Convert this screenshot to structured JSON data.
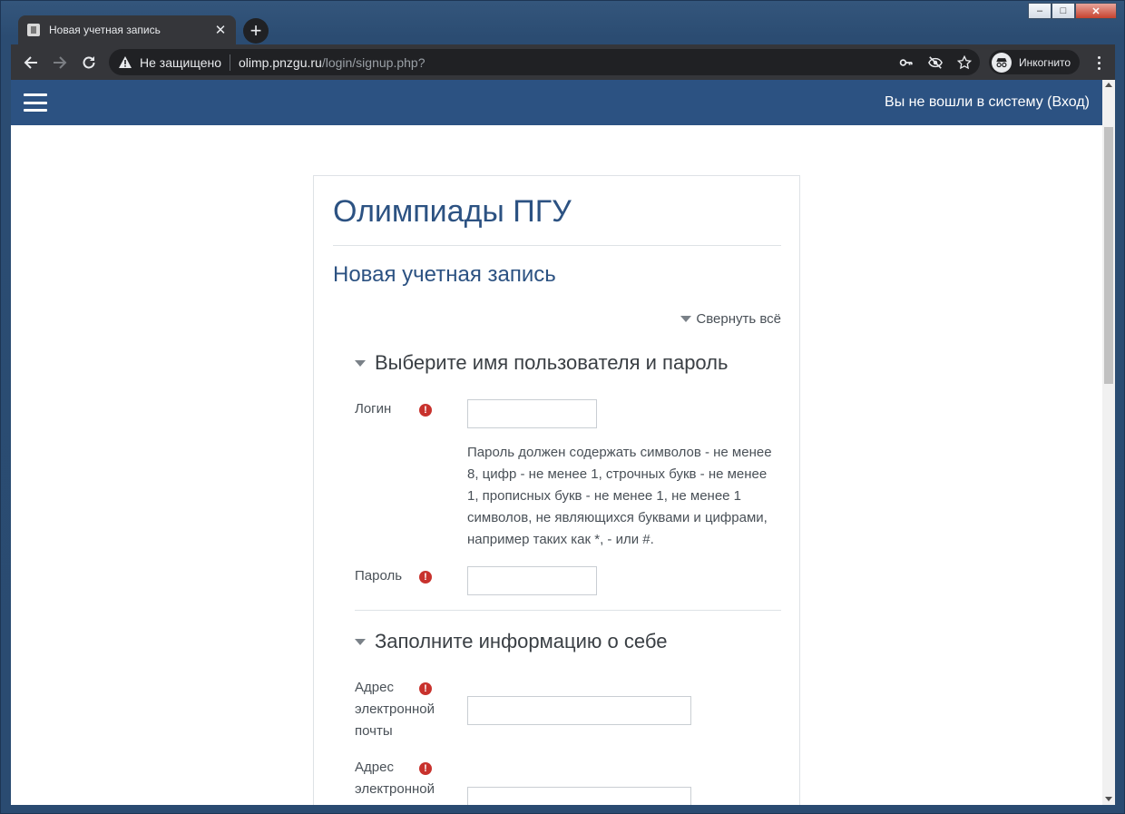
{
  "browser": {
    "tab_title": "Новая учетная запись",
    "security_label": "Не защищено",
    "url_host": "olimp.pnzgu.ru",
    "url_path": "/login/signup.php?",
    "incognito_label": "Инкогнито"
  },
  "navbar": {
    "login_status": "Вы не вошли в систему (Вход)"
  },
  "page": {
    "site_title": "Олимпиады ПГУ",
    "page_title": "Новая учетная запись",
    "collapse_all": "Свернуть всё"
  },
  "section1": {
    "title": "Выберите имя пользователя и пароль",
    "login_label": "Логин",
    "login_value": "",
    "password_help": "Пароль должен содержать символов - не менее 8, цифр - не менее 1, строчных букв - не менее 1, прописных букв - не менее 1, не менее 1 символов, не являющихся буквами и цифрами, например таких как *, - или #.",
    "password_label": "Пароль",
    "password_value": ""
  },
  "section2": {
    "title": "Заполните информацию о себе",
    "email_label": "Адрес электронной почты",
    "email_value": "",
    "email2_label": "Адрес электронной",
    "email2_value": ""
  },
  "icons": {
    "required": "!",
    "tab_close": "✕",
    "new_tab": "+"
  }
}
